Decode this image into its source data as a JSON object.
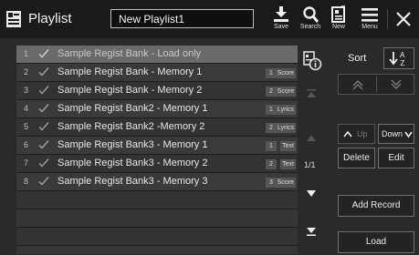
{
  "header": {
    "title": "Playlist",
    "playlist_name": "New Playlist1",
    "save_label": "Save",
    "search_label": "Search",
    "new_label": "New",
    "menu_label": "Menu"
  },
  "records": [
    {
      "num": "1",
      "name": "Sample Regist Bank - Load only",
      "count": "",
      "type": ""
    },
    {
      "num": "2",
      "name": "Sample Regist Bank - Memory 1",
      "count": "1",
      "type": "Score"
    },
    {
      "num": "3",
      "name": "Sample Regist Bank - Memory 2",
      "count": "2",
      "type": "Score"
    },
    {
      "num": "4",
      "name": "Sample Regist Bank2 - Memory 1",
      "count": "1",
      "type": "Lyrics"
    },
    {
      "num": "5",
      "name": "Sample Regist Bank2 -Memory 2",
      "count": "2",
      "type": "Lyrics"
    },
    {
      "num": "6",
      "name": "Sample Regist Bank3 - Memory 1",
      "count": "1",
      "type": "Text"
    },
    {
      "num": "7",
      "name": "Sample Regist Bank3 - Memory 2",
      "count": "2",
      "type": "Text"
    },
    {
      "num": "8",
      "name": "Sample Regist Bank3 - Memory 3",
      "count": "3",
      "type": "Score"
    }
  ],
  "pager": "1/1",
  "side": {
    "sort_label": "Sort",
    "up_label": "Up",
    "down_label": "Down",
    "delete_label": "Delete",
    "edit_label": "Edit",
    "add_record_label": "Add Record",
    "load_label": "Load"
  }
}
